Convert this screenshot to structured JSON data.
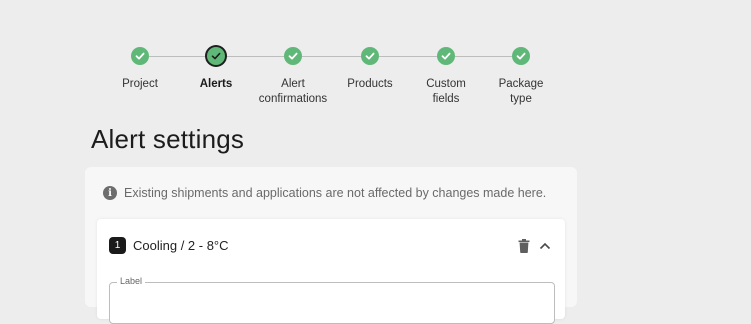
{
  "stepper": {
    "steps": [
      {
        "label": "Project",
        "state": "done"
      },
      {
        "label": "Alerts",
        "state": "active"
      },
      {
        "label": "Alert\nconfirmations",
        "state": "done"
      },
      {
        "label": "Products",
        "state": "done"
      },
      {
        "label": "Custom\nfields",
        "state": "done"
      },
      {
        "label": "Package\ntype",
        "state": "done"
      }
    ]
  },
  "page": {
    "title": "Alert settings"
  },
  "info": {
    "text": "Existing shipments and applications are not affected by changes made here."
  },
  "alert": {
    "number": "1",
    "title": "Cooling / 2 - 8°C",
    "label_field": {
      "legend": "Label",
      "value": ""
    }
  },
  "colors": {
    "step_done": "#5fb878",
    "background": "#ededed",
    "card": "#f7f7f7"
  },
  "icons": {
    "step": "check-icon",
    "info": "info-icon",
    "delete": "trash-icon",
    "collapse": "chevron-up-icon"
  }
}
